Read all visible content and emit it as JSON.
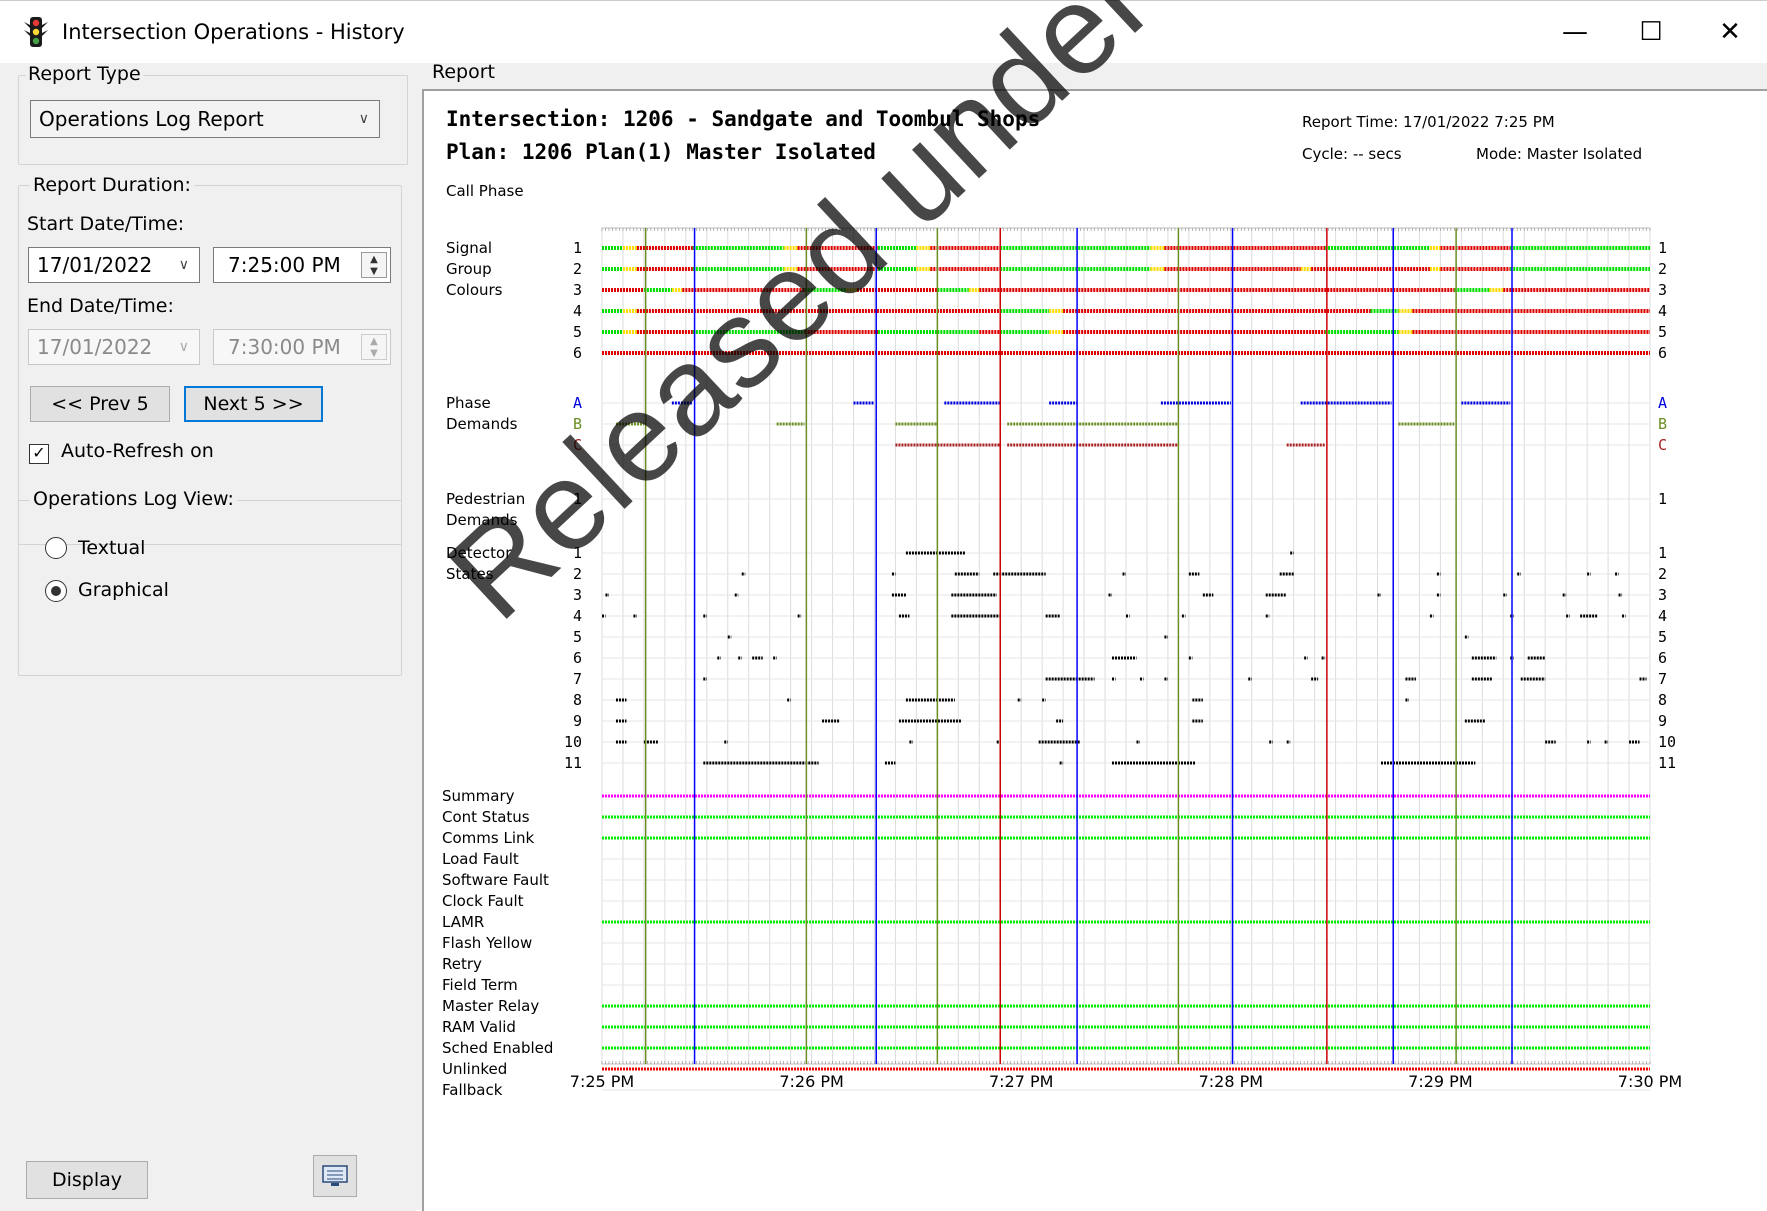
{
  "window": {
    "title": "Intersection Operations - History",
    "minimize": "—",
    "maximize": "☐",
    "close": "✕"
  },
  "left": {
    "report_type_label": "Report Type",
    "report_type_value": "Operations Log Report",
    "duration_label": "Report Duration:",
    "start_label": "Start Date/Time:",
    "start_date": "17/01/2022",
    "start_time": "7:25:00 PM",
    "end_label": "End Date/Time:",
    "end_date": "17/01/2022",
    "end_time": "7:30:00 PM",
    "prev_button": "<< Prev 5",
    "next_button": "Next 5 >>",
    "autorefresh_label": "Auto-Refresh on",
    "autorefresh_checked": true,
    "view_label": "Operations Log View:",
    "view_textual": "Textual",
    "view_graphical": "Graphical",
    "selected_view": "Graphical",
    "display_button": "Display",
    "export_icon": "monitor-icon"
  },
  "report": {
    "label": "Report",
    "watermark": "Released under RTI-DTMR",
    "chart_data": {
      "type": "timeline",
      "title": "Intersection: 1206 - Sandgate and Toombul Shops",
      "subtitle": "Plan: 1206 Plan(1) Master Isolated",
      "report_time": "Report Time: 17/01/2022 7:25 PM",
      "cycle": "Cycle: -- secs",
      "mode": "Mode: Master Isolated",
      "call_phase_label": "Call Phase",
      "x_ticks": [
        "7:25 PM",
        "7:26 PM",
        "7:27 PM",
        "7:28 PM",
        "7:29 PM",
        "7:30 PM"
      ],
      "x_range_seconds": [
        0,
        300
      ],
      "cycle_markers": [
        {
          "t": 12.5,
          "color": "#6b8e23"
        },
        {
          "t": 26.5,
          "color": "#0000ff"
        },
        {
          "t": 58.5,
          "color": "#6b8e23"
        },
        {
          "t": 78.5,
          "color": "#0000ff"
        },
        {
          "t": 96,
          "color": "#6b8e23"
        },
        {
          "t": 114,
          "color": "#cc0000"
        },
        {
          "t": 136,
          "color": "#0000ff"
        },
        {
          "t": 165,
          "color": "#6b8e23"
        },
        {
          "t": 180.5,
          "color": "#0000ff"
        },
        {
          "t": 207.5,
          "color": "#cc0000"
        },
        {
          "t": 226.5,
          "color": "#0000ff"
        },
        {
          "t": 244.5,
          "color": "#6b8e23"
        },
        {
          "t": 260.5,
          "color": "#0000ff"
        }
      ],
      "signal_group_label": "Signal Group Colours",
      "signal_groups": [
        {
          "name": "1",
          "segments": [
            [
              0,
              6,
              "G"
            ],
            [
              6,
              10,
              "Y"
            ],
            [
              10,
              26,
              "R"
            ],
            [
              26,
              52,
              "G"
            ],
            [
              52,
              56,
              "Y"
            ],
            [
              56,
              79,
              "R"
            ],
            [
              79,
              90,
              "G"
            ],
            [
              90,
              94,
              "Y"
            ],
            [
              94,
              114,
              "R"
            ],
            [
              114,
              157,
              "G"
            ],
            [
              157,
              161,
              "Y"
            ],
            [
              161,
              207,
              "R"
            ],
            [
              207,
              237,
              "G"
            ],
            [
              237,
              240,
              "Y"
            ],
            [
              240,
              260,
              "R"
            ],
            [
              260,
              300,
              "G"
            ]
          ]
        },
        {
          "name": "2",
          "segments": [
            [
              0,
              6,
              "G"
            ],
            [
              6,
              10,
              "Y"
            ],
            [
              10,
              26,
              "R"
            ],
            [
              26,
              52,
              "G"
            ],
            [
              52,
              56,
              "Y"
            ],
            [
              56,
              79,
              "R"
            ],
            [
              79,
              90,
              "G"
            ],
            [
              90,
              94,
              "Y"
            ],
            [
              94,
              114,
              "R"
            ],
            [
              114,
              157,
              "G"
            ],
            [
              157,
              161,
              "Y"
            ],
            [
              161,
              200,
              "R"
            ],
            [
              200,
              203,
              "Y"
            ],
            [
              203,
              237,
              "R"
            ],
            [
              237,
              240,
              "Y"
            ],
            [
              240,
              260,
              "R"
            ],
            [
              260,
              300,
              "G"
            ]
          ]
        },
        {
          "name": "3",
          "segments": [
            [
              0,
              12,
              "R"
            ],
            [
              12,
              20,
              "G"
            ],
            [
              20,
              23,
              "Y"
            ],
            [
              23,
              58,
              "R"
            ],
            [
              58,
              70,
              "G"
            ],
            [
              70,
              73,
              "Y"
            ],
            [
              73,
              96,
              "R"
            ],
            [
              96,
              105,
              "G"
            ],
            [
              105,
              108,
              "Y"
            ],
            [
              108,
              244,
              "R"
            ],
            [
              244,
              254,
              "G"
            ],
            [
              254,
              258,
              "Y"
            ],
            [
              258,
              300,
              "R"
            ]
          ]
        },
        {
          "name": "4",
          "segments": [
            [
              0,
              6,
              "G"
            ],
            [
              6,
              10,
              "Y"
            ],
            [
              10,
              114,
              "R"
            ],
            [
              114,
              128,
              "G"
            ],
            [
              128,
              132,
              "Y"
            ],
            [
              132,
              220,
              "R"
            ],
            [
              220,
              228,
              "G"
            ],
            [
              228,
              232,
              "Y"
            ],
            [
              232,
              300,
              "R"
            ]
          ]
        },
        {
          "name": "5",
          "segments": [
            [
              0,
              6,
              "G"
            ],
            [
              6,
              10,
              "Y"
            ],
            [
              10,
              26,
              "R"
            ],
            [
              26,
              58,
              "G"
            ],
            [
              58,
              79,
              "R"
            ],
            [
              79,
              96,
              "G"
            ],
            [
              96,
              108,
              "G"
            ],
            [
              108,
              114,
              "R"
            ],
            [
              114,
              128,
              "G"
            ],
            [
              128,
              132,
              "Y"
            ],
            [
              132,
              207,
              "R"
            ],
            [
              207,
              228,
              "G"
            ],
            [
              228,
              232,
              "Y"
            ],
            [
              232,
              300,
              "R"
            ]
          ]
        },
        {
          "name": "6",
          "segments": [
            [
              0,
              300,
              "R"
            ]
          ]
        }
      ],
      "phase_label": "Phase Demands",
      "phases": [
        {
          "name": "A",
          "color": "#0000dd",
          "segments": [
            [
              20,
              26
            ],
            [
              72,
              78
            ],
            [
              98,
              114
            ],
            [
              128,
              136
            ],
            [
              160,
              180
            ],
            [
              200,
              226
            ],
            [
              246,
              260
            ]
          ]
        },
        {
          "name": "B",
          "color": "#6b8e23",
          "segments": [
            [
              4,
              12
            ],
            [
              50,
              58
            ],
            [
              84,
              96
            ],
            [
              116,
              165
            ],
            [
              228,
              244
            ]
          ]
        },
        {
          "name": "C",
          "color": "#aa2222",
          "segments": [
            [
              84,
              114
            ],
            [
              116,
              165
            ],
            [
              196,
              207
            ]
          ]
        }
      ],
      "ped_label": "Pedestrian Demands",
      "pedestrian": [
        {
          "name": "1",
          "segments": []
        }
      ],
      "detector_label": "Detector States",
      "detectors": [
        {
          "name": "1",
          "segments": [
            [
              87,
              104
            ],
            [
              197,
              198
            ]
          ]
        },
        {
          "name": "2",
          "segments": [
            [
              40,
              41
            ],
            [
              83,
              84
            ],
            [
              101,
              108
            ],
            [
              112,
              127
            ],
            [
              149,
              150
            ],
            [
              168,
              171
            ],
            [
              194,
              198
            ],
            [
              239,
              240
            ],
            [
              262,
              263
            ],
            [
              282,
              283
            ],
            [
              290,
              291
            ]
          ]
        },
        {
          "name": "3",
          "segments": [
            [
              1,
              2
            ],
            [
              38,
              39
            ],
            [
              83,
              87
            ],
            [
              100,
              113
            ],
            [
              145,
              146
            ],
            [
              172,
              175
            ],
            [
              190,
              196
            ],
            [
              222,
              223
            ],
            [
              239,
              240
            ],
            [
              258,
              259
            ],
            [
              275,
              276
            ],
            [
              291,
              292
            ]
          ]
        },
        {
          "name": "4",
          "segments": [
            [
              0,
              1
            ],
            [
              9,
              10
            ],
            [
              29,
              30
            ],
            [
              56,
              57
            ],
            [
              85,
              88
            ],
            [
              100,
              114
            ],
            [
              127,
              131
            ],
            [
              150,
              151
            ],
            [
              166,
              167
            ],
            [
              190,
              191
            ],
            [
              237,
              238
            ],
            [
              260,
              261
            ],
            [
              276,
              277
            ],
            [
              280,
              285
            ],
            [
              292,
              293
            ]
          ]
        },
        {
          "name": "5",
          "segments": [
            [
              36,
              37
            ],
            [
              161,
              162
            ],
            [
              247,
              248
            ]
          ]
        },
        {
          "name": "6",
          "segments": [
            [
              33,
              34
            ],
            [
              39,
              40
            ],
            [
              43,
              46
            ],
            [
              49,
              50
            ],
            [
              146,
              153
            ],
            [
              168,
              169
            ],
            [
              201,
              202
            ],
            [
              206,
              207
            ],
            [
              249,
              256
            ],
            [
              260,
              261
            ],
            [
              265,
              270
            ]
          ]
        },
        {
          "name": "7",
          "segments": [
            [
              29,
              30
            ],
            [
              127,
              141
            ],
            [
              146,
              147
            ],
            [
              154,
              155
            ],
            [
              161,
              162
            ],
            [
              185,
              186
            ],
            [
              203,
              205
            ],
            [
              230,
              233
            ],
            [
              249,
              255
            ],
            [
              263,
              270
            ],
            [
              297,
              299
            ]
          ]
        },
        {
          "name": "8",
          "segments": [
            [
              4,
              7
            ],
            [
              53,
              54
            ],
            [
              87,
              101
            ],
            [
              119,
              120
            ],
            [
              126,
              127
            ],
            [
              169,
              172
            ],
            [
              230,
              231
            ]
          ]
        },
        {
          "name": "9",
          "segments": [
            [
              4,
              7
            ],
            [
              63,
              68
            ],
            [
              85,
              103
            ],
            [
              130,
              132
            ],
            [
              169,
              172
            ],
            [
              247,
              253
            ]
          ]
        },
        {
          "name": "10",
          "segments": [
            [
              4,
              7
            ],
            [
              12,
              16
            ],
            [
              35,
              36
            ],
            [
              88,
              89
            ],
            [
              113,
              114
            ],
            [
              125,
              137
            ],
            [
              153,
              154
            ],
            [
              191,
              192
            ],
            [
              196,
              197
            ],
            [
              270,
              273
            ],
            [
              282,
              283
            ],
            [
              287,
              288
            ],
            [
              294,
              297
            ]
          ]
        },
        {
          "name": "11",
          "segments": [
            [
              29,
              62
            ],
            [
              81,
              84
            ],
            [
              131,
              132
            ],
            [
              146,
              170
            ],
            [
              223,
              250
            ]
          ]
        }
      ],
      "status_rows": [
        {
          "name": "Summary",
          "color": "#ff00ff"
        },
        {
          "name": "Cont Status",
          "color": "#00ee00"
        },
        {
          "name": "Comms Link",
          "color": "#00ee00"
        },
        {
          "name": "Load Fault",
          "color": ""
        },
        {
          "name": "Software Fault",
          "color": ""
        },
        {
          "name": "Clock Fault",
          "color": ""
        },
        {
          "name": "LAMR",
          "color": "#00ee00"
        },
        {
          "name": "Flash Yellow",
          "color": ""
        },
        {
          "name": "Retry",
          "color": ""
        },
        {
          "name": "Field Term",
          "color": ""
        },
        {
          "name": "Master Relay",
          "color": "#00ee00"
        },
        {
          "name": "RAM Valid",
          "color": "#00ee00"
        },
        {
          "name": "Sched Enabled",
          "color": "#00ee00"
        },
        {
          "name": "Unlinked",
          "color": "#ee0000"
        },
        {
          "name": "Fallback",
          "color": ""
        }
      ],
      "colors": {
        "G": "#00e000",
        "Y": "#ffdd00",
        "R": "#e00000",
        "grid": "#dcdcdc",
        "detector": "#000000"
      }
    }
  }
}
